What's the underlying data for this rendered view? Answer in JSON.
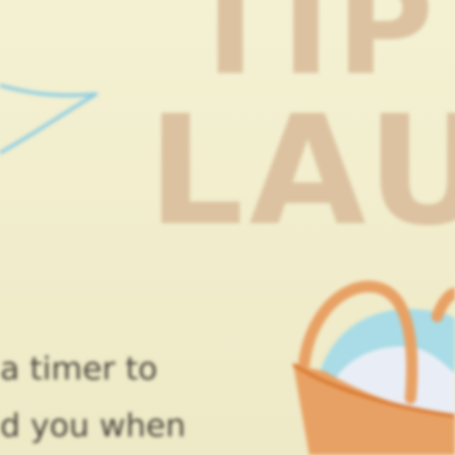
{
  "poster": {
    "title_line_1": "TIP",
    "title_line_2": "LAU",
    "body_line_1": "a timer to",
    "body_line_2": "d you when"
  },
  "colors": {
    "background": "#f3efcd",
    "title": "#dcc2a0",
    "body_text": "#4a463d",
    "basket": "#e8a164",
    "basket_outline": "#d9772f",
    "laundry": "#a9dce6",
    "doodle_line": "#8ecde2"
  },
  "icons": {
    "laundry_basket": "laundry-basket-illustration",
    "doodle": "blue-line-doodle"
  }
}
